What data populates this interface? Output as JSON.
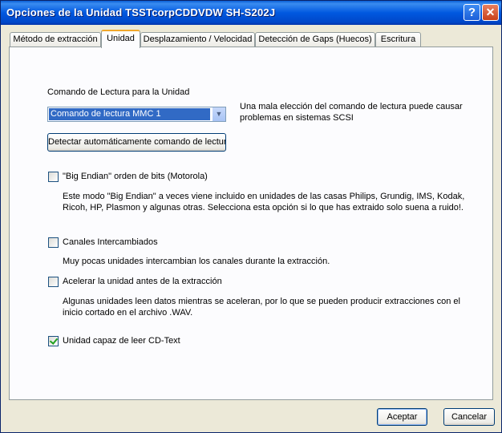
{
  "window": {
    "title": "Opciones de la Unidad TSSTcorpCDDVDW SH-S202J"
  },
  "titlebar_buttons": {
    "help": "?",
    "close": "✕"
  },
  "tabs": [
    {
      "label": "Método de extracción"
    },
    {
      "label": "Unidad"
    },
    {
      "label": "Desplazamiento / Velocidad"
    },
    {
      "label": "Detección de Gaps (Huecos)"
    },
    {
      "label": "Escritura"
    }
  ],
  "drive": {
    "read_command_label": "Comando de Lectura para la Unidad",
    "read_command_value": "Comando de lectura MMC 1",
    "warning_line1": "Una mala elección del comando de lectura puede causar",
    "warning_line2": "problemas en sistemas SCSI",
    "detect_button": "Detectar automáticamente comando de lectura"
  },
  "options": {
    "big_endian": {
      "label": "\"Big Endian\" orden de bits (Motorola)",
      "desc1": "Este modo \"Big Endian\" a veces viene incluido en unidades de las casas Philips, Grundig, IMS, Kodak,",
      "desc2": "Ricoh, HP, Plasmon y algunas otras. Selecciona esta opción si lo que has extraido solo suena a ruido!.",
      "checked": false
    },
    "swap_channels": {
      "label": "Canales Intercambiados",
      "desc1": "Muy pocas unidades intercambian los canales durante la extracción.",
      "checked": false
    },
    "spin_up": {
      "label": "Acelerar la unidad antes de la extracción",
      "desc1": "Algunas unidades leen datos mientras se aceleran, por lo que se pueden producir extracciones con el",
      "desc2": "inicio cortado en el archivo .WAV.",
      "checked": false
    },
    "cd_text": {
      "label": "Unidad capaz de leer CD-Text",
      "checked": true
    }
  },
  "footer": {
    "ok": "Aceptar",
    "cancel": "Cancelar"
  },
  "icons": {
    "dropdown": "chevron-down-icon"
  },
  "colors": {
    "titlebar": "#0058e0",
    "selection": "#316ac5",
    "tab_highlight": "#f1a82b",
    "window_bg": "#ece9d8"
  }
}
